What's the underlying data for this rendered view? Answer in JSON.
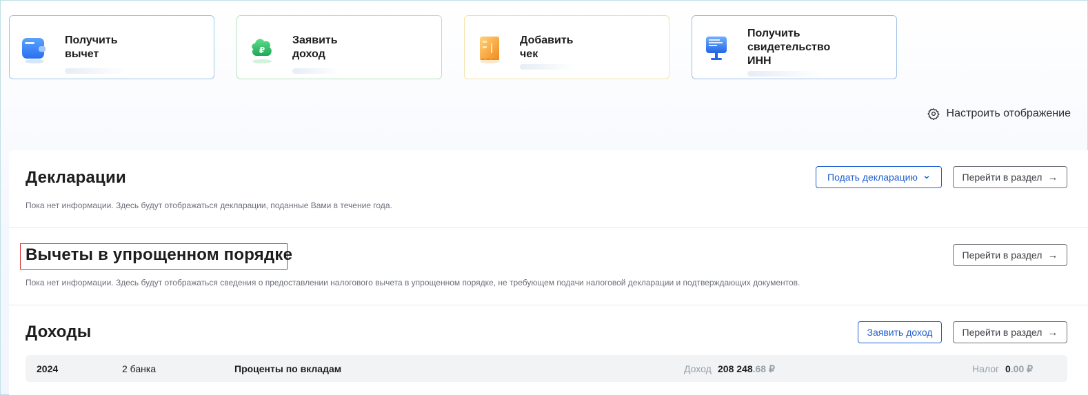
{
  "quick_actions": [
    {
      "line1": "Получить",
      "line2": "вычет",
      "icon": "wallet-icon",
      "color": "#3b82f6"
    },
    {
      "line1": "Заявить",
      "line2": "доход",
      "icon": "ruble-cloud-icon",
      "color": "#22c55e"
    },
    {
      "line1": "Добавить",
      "line2": "чек",
      "icon": "receipt-icon",
      "color": "#f59e0b"
    },
    {
      "line1": "Получить",
      "line2": "свидетельство",
      "line3": "ИНН",
      "icon": "certificate-screen-icon",
      "color": "#2563eb"
    }
  ],
  "settings": {
    "label": "Настроить отображение",
    "icon": "gear-icon"
  },
  "declarations": {
    "title": "Декларации",
    "note": "Пока нет информации. Здесь будут отображаться декларации, поданные Вами в течение года.",
    "submit_button": "Подать декларацию",
    "goto_button": "Перейти в раздел"
  },
  "simplified": {
    "title": "Вычеты в упрощенном порядке",
    "note": "Пока нет информации. Здесь будут отображаться сведения о предоставлении налогового вычета в упрощенном порядке, не требующем подачи налоговой декларации и подтверждающих документов.",
    "goto_button": "Перейти в раздел"
  },
  "income": {
    "title": "Доходы",
    "declare_button": "Заявить доход",
    "goto_button": "Перейти в раздел",
    "row": {
      "year": "2024",
      "banks": "2 банка",
      "type": "Проценты по вкладам",
      "income_label": "Доход",
      "income_int": "208 248",
      "income_frac": ".68 ₽",
      "tax_label": "Налог",
      "tax_int": "0",
      "tax_frac": ".00 ₽"
    }
  },
  "colors": {
    "accent_blue": "#1f5fd1",
    "highlight_red": "#d42d2d"
  }
}
